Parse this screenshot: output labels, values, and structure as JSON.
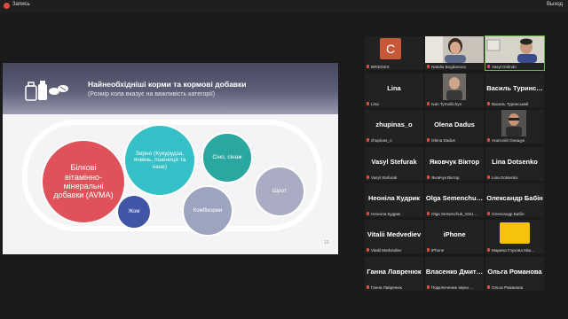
{
  "topbar": {
    "recording_label": "Запись",
    "exit_label": "Выход"
  },
  "slide": {
    "title": "Найнеобхідніші корми та кормові добавки",
    "subtitle": "(Розмір кола вказує на важливість категорії)",
    "page_number": "10",
    "circles": [
      {
        "label": "Білкові вітамінно-мінеральні добавки (AVMA)",
        "color": "#e0525a"
      },
      {
        "label": "Зерно (Кукурудза, ячмінь, пшениця та інше)",
        "color": "#35bfc6"
      },
      {
        "label": "Сіно, сінаж",
        "color": "#2aa7a0"
      },
      {
        "label": "Жом",
        "color": "#3f55a6"
      },
      {
        "label": "Комбікорми",
        "color": "#9da4bf"
      },
      {
        "label": "Шрот",
        "color": "#a9acc2"
      }
    ]
  },
  "participants": [
    {
      "big": "",
      "caption": "BRIDGES",
      "avatar": "C"
    },
    {
      "big": "",
      "caption": "Natalia Bogdanova"
    },
    {
      "big": "",
      "caption": "Vasyl Dolindo"
    },
    {
      "big": "Lina",
      "caption": "Lina"
    },
    {
      "big": "",
      "caption": "Ivan Tymofiichyn"
    },
    {
      "big": "Василь Туринс…",
      "caption": "Василь Туринський"
    },
    {
      "big": "zhupinas_o",
      "caption": "zhupinas_o"
    },
    {
      "big": "Olena Dadus",
      "caption": "Olena Dadus"
    },
    {
      "big": "",
      "caption": "Анатолій Онищук"
    },
    {
      "big": "Vasyl Stefurak",
      "caption": "Vasyl Stefurak"
    },
    {
      "big": "Яковчук Віктор",
      "caption": "Яковчук Віктор"
    },
    {
      "big": "Lina Dotsenko",
      "caption": "Lina Dotsenko"
    },
    {
      "big": "Неоніла Кудрик",
      "caption": "Неоніла Кудрик"
    },
    {
      "big": "Olga Semenchu…",
      "caption": "Olga Semenchuk_SSU…"
    },
    {
      "big": "Олександр Бабін",
      "caption": "Олександр Бабін"
    },
    {
      "big": "Vitalii Medvediev",
      "caption": "Vitalii Medvediev"
    },
    {
      "big": "iPhone",
      "caption": "iPhone"
    },
    {
      "big": "",
      "caption": "Марина Глухова Між…",
      "card": ""
    },
    {
      "big": "Ганна Лавренюк",
      "caption": "Ганна Лавренюк"
    },
    {
      "big": "Власенко Дмит…",
      "caption": "Подключение звука ..."
    },
    {
      "big": "Ольга Романова",
      "caption": "Ольга Романова"
    }
  ]
}
